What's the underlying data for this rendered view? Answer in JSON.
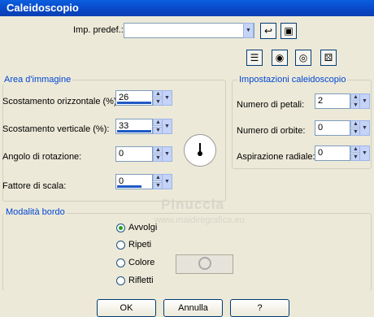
{
  "window": {
    "title": "Caleidoscopio"
  },
  "preset": {
    "label": "Imp. predef.:",
    "value": ""
  },
  "toolbar_icons": [
    "undo-icon",
    "save-icon",
    "preview-icon",
    "reset-icon",
    "eye-icon",
    "randomize-icon"
  ],
  "area": {
    "title": "Area d'immagine",
    "fields": [
      {
        "label": "Scostamento orizzontale (%):",
        "value": "26",
        "fill": 1.0
      },
      {
        "label": "Scostamento verticale (%):",
        "value": "33",
        "fill": 1.0
      },
      {
        "label": "Angolo di rotazione:",
        "value": "0",
        "fill": 0.0
      },
      {
        "label": "Fattore di scala:",
        "value": "0",
        "fill": 0.7
      }
    ]
  },
  "kaleido": {
    "title": "Impostazioni caleidoscopio",
    "fields": [
      {
        "label": "Numero di petali:",
        "value": "2"
      },
      {
        "label": "Numero di orbite:",
        "value": "0"
      },
      {
        "label": "Aspirazione radiale:",
        "value": "0"
      }
    ]
  },
  "border": {
    "title": "Modalità bordo",
    "options": [
      "Avvolgi",
      "Ripeti",
      "Colore",
      "Rifletti"
    ],
    "selected": "Avvolgi"
  },
  "watermark": {
    "line1": "Pinuccia",
    "line2": "www.maidiregrafica.eu"
  },
  "buttons": {
    "ok": "OK",
    "cancel": "Annulla",
    "help": "?"
  }
}
